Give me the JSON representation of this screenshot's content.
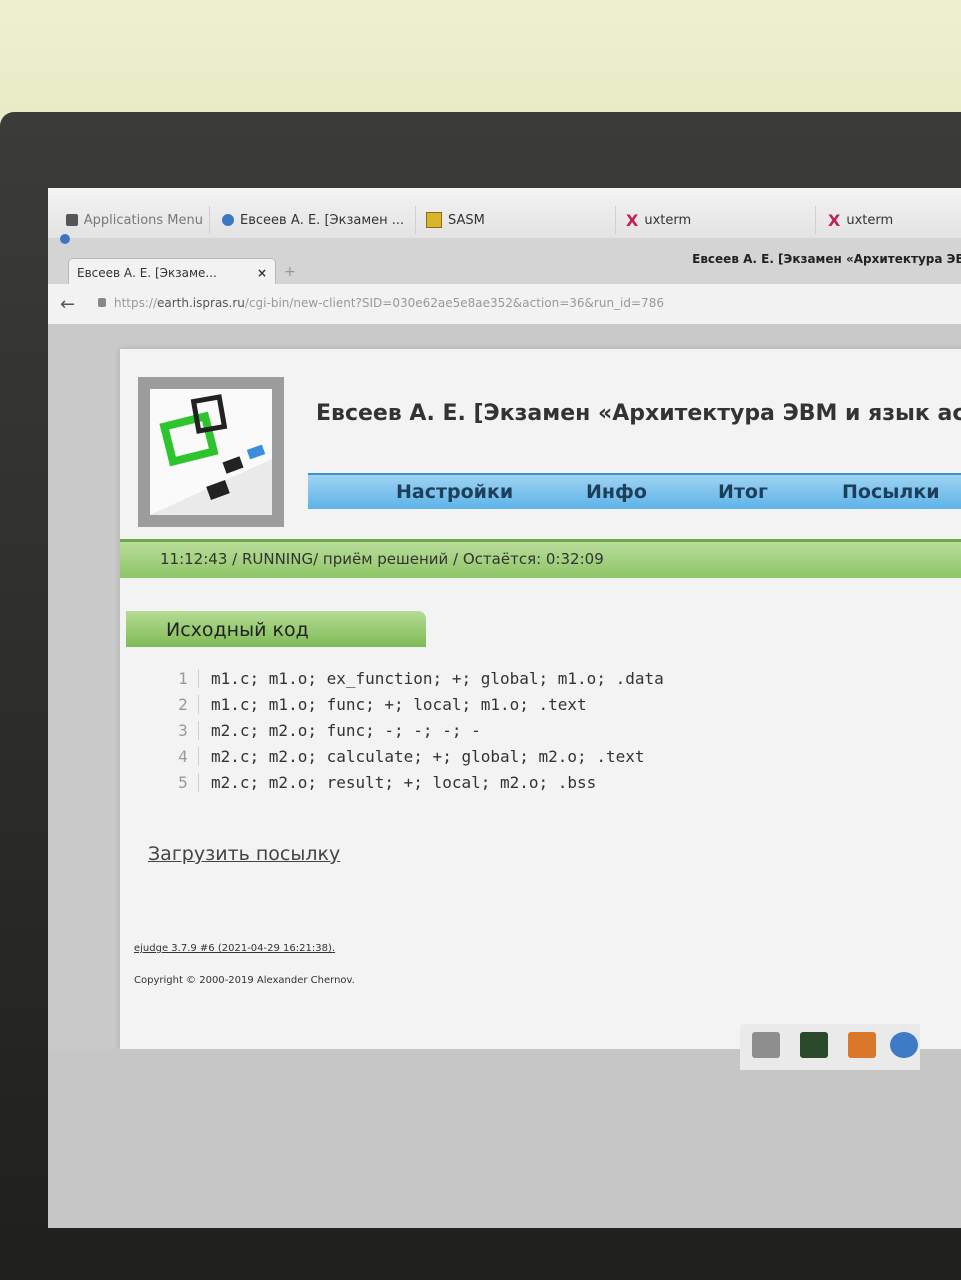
{
  "taskbar": {
    "apps_menu": "Applications Menu",
    "tasks": [
      {
        "label": "Евсеев А. Е. [Экзамен ...",
        "icon": "browser-icon"
      },
      {
        "label": "SASM",
        "icon": "sasm-icon"
      },
      {
        "label": "uxterm",
        "icon": "xterm-icon"
      },
      {
        "label": "uxterm",
        "icon": "xterm-icon"
      }
    ]
  },
  "browser": {
    "window_title": "Евсеев А. Е. [Экзамен «Архитектура ЭВМ и я",
    "tab_label": "Евсеев А. Е. [Экзаме...",
    "tab_close": "×",
    "new_tab": "+",
    "url_prefix": "https://",
    "url_host": "earth.ispras.ru",
    "url_path": "/cgi-bin/new-client?SID=030e62ae5e8ae352&action=36&run_id=786"
  },
  "page": {
    "title": "Евсеев А. Е. [Экзамен «Архитектура ЭВМ и язык ассе",
    "menu": [
      "Настройки",
      "Инфо",
      "Итог",
      "Посылки"
    ],
    "status": "11:12:43 / RUNNING/ приём решений / Остаётся: 0:32:09",
    "section_title": "Исходный код",
    "code": [
      {
        "n": "1",
        "text": "m1.c; m1.o; ex_function; +; global; m1.o; .data"
      },
      {
        "n": "2",
        "text": "m1.c; m1.o; func; +; local; m1.o; .text"
      },
      {
        "n": "3",
        "text": "m2.c; m2.o; func; -; -; -; -"
      },
      {
        "n": "4",
        "text": "m2.c; m2.o; calculate; +; global; m2.o; .text"
      },
      {
        "n": "5",
        "text": "m2.c; m2.o; result; +; local; m2.o; .bss"
      }
    ],
    "submit_link": "Загрузить посылку",
    "version_link": "ejudge 3.7.9 #6 (2021-04-29 16:21:38).",
    "copyright": "Copyright © 2000-2019 Alexander Chernov."
  },
  "colors": {
    "menu_bar": "#5eb3e8",
    "status_bar": "#8ec466",
    "logo_green": "#2ec42e"
  }
}
